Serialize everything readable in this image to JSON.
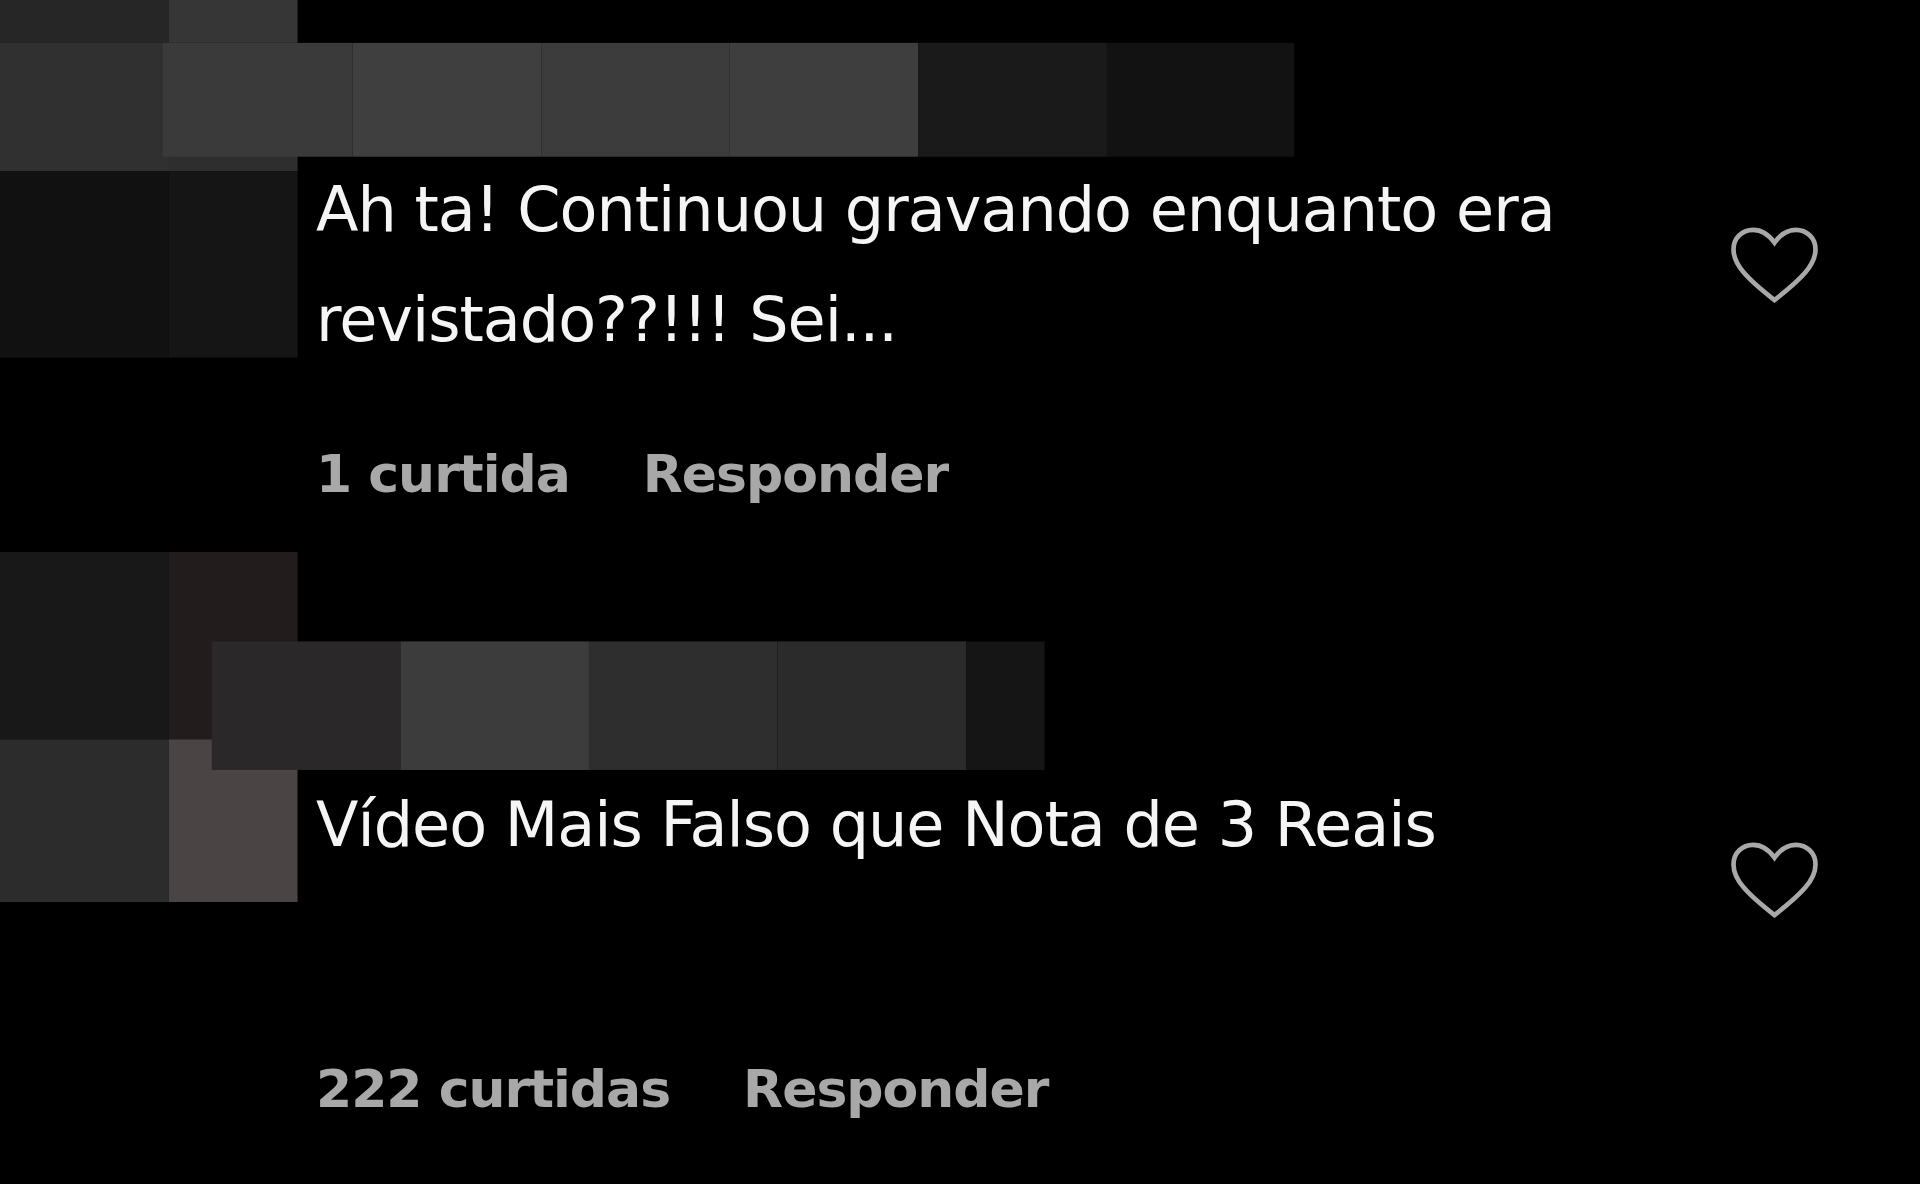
{
  "comments": [
    {
      "text": "Ah ta! Continuou gravando enquanto era revistado??!!! Sei...",
      "likes": "1 curtida",
      "reply": "Responder",
      "liked": false
    },
    {
      "text": "Vídeo Mais Falso que Nota de 3 Reais",
      "likes": "222 curtidas",
      "reply": "Responder",
      "liked": false
    }
  ]
}
